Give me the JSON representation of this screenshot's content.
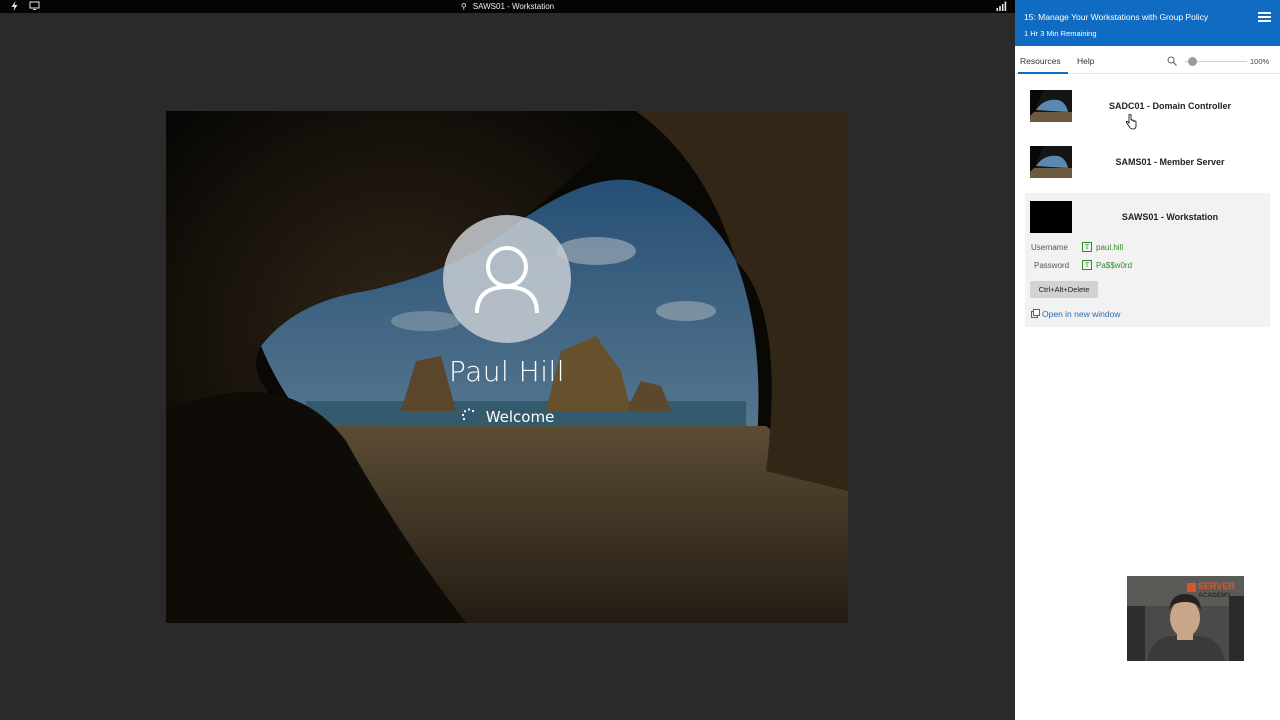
{
  "topbar": {
    "title": "SAWS01 - Workstation",
    "icons": [
      "lightning-icon",
      "monitor-icon",
      "pin-icon",
      "signal-bars-icon"
    ]
  },
  "vm": {
    "user_name": "Paul Hill",
    "status_text": "Welcome"
  },
  "panel": {
    "title": "15: Manage Your Workstations with Group Policy",
    "time_remaining": "1 Hr 3 Min Remaining",
    "tabs": [
      {
        "label": "Resources",
        "active": true
      },
      {
        "label": "Help",
        "active": false
      }
    ],
    "zoom_label": "100%",
    "zoom_level": 0.1,
    "resources": [
      {
        "name": "SADC01 - Domain Controller",
        "thumbnail": "windows-desktop-thumbnail"
      },
      {
        "name": "SAMS01 - Member Server",
        "thumbnail": "windows-desktop-thumbnail"
      },
      {
        "name": "SAWS01 - Workstation",
        "thumbnail": "black-screen-thumbnail",
        "selected": true
      }
    ],
    "credentials": {
      "username_label": "Username",
      "username_value": "paul.hill",
      "password_label": "Password",
      "password_value": "Pa$$w0rd"
    },
    "cad_button": "Ctrl+Alt+Delete",
    "open_new_window": "Open in new window"
  },
  "webcam": {
    "logo_line1": "SERVER",
    "logo_line2": "ACADEMY"
  },
  "colors": {
    "header_blue": "#0f6cc2",
    "credential_green": "#2e8b2e",
    "link_blue": "#2b6cb0"
  }
}
